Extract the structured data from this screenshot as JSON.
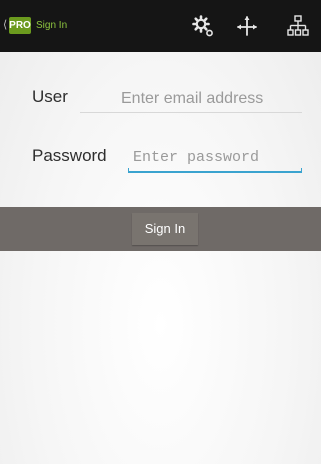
{
  "action_bar": {
    "logo_text": "PRO",
    "title": "Sign In",
    "background_color": "#151515",
    "title_color": "#8ec63f",
    "logo_color": "#6b9a1e",
    "actions": [
      {
        "icon": "settings-gears-icon"
      },
      {
        "icon": "move-arrows-icon"
      },
      {
        "icon": "network-tree-icon"
      }
    ]
  },
  "form": {
    "user": {
      "label": "User",
      "value": "",
      "placeholder": "Enter email address"
    },
    "password": {
      "label": "Password",
      "value": "",
      "placeholder": "Enter password"
    },
    "focus_color": "#3aa3cf"
  },
  "button_strip": {
    "sign_in_label": "Sign In",
    "background_color": "#6f6a67"
  }
}
